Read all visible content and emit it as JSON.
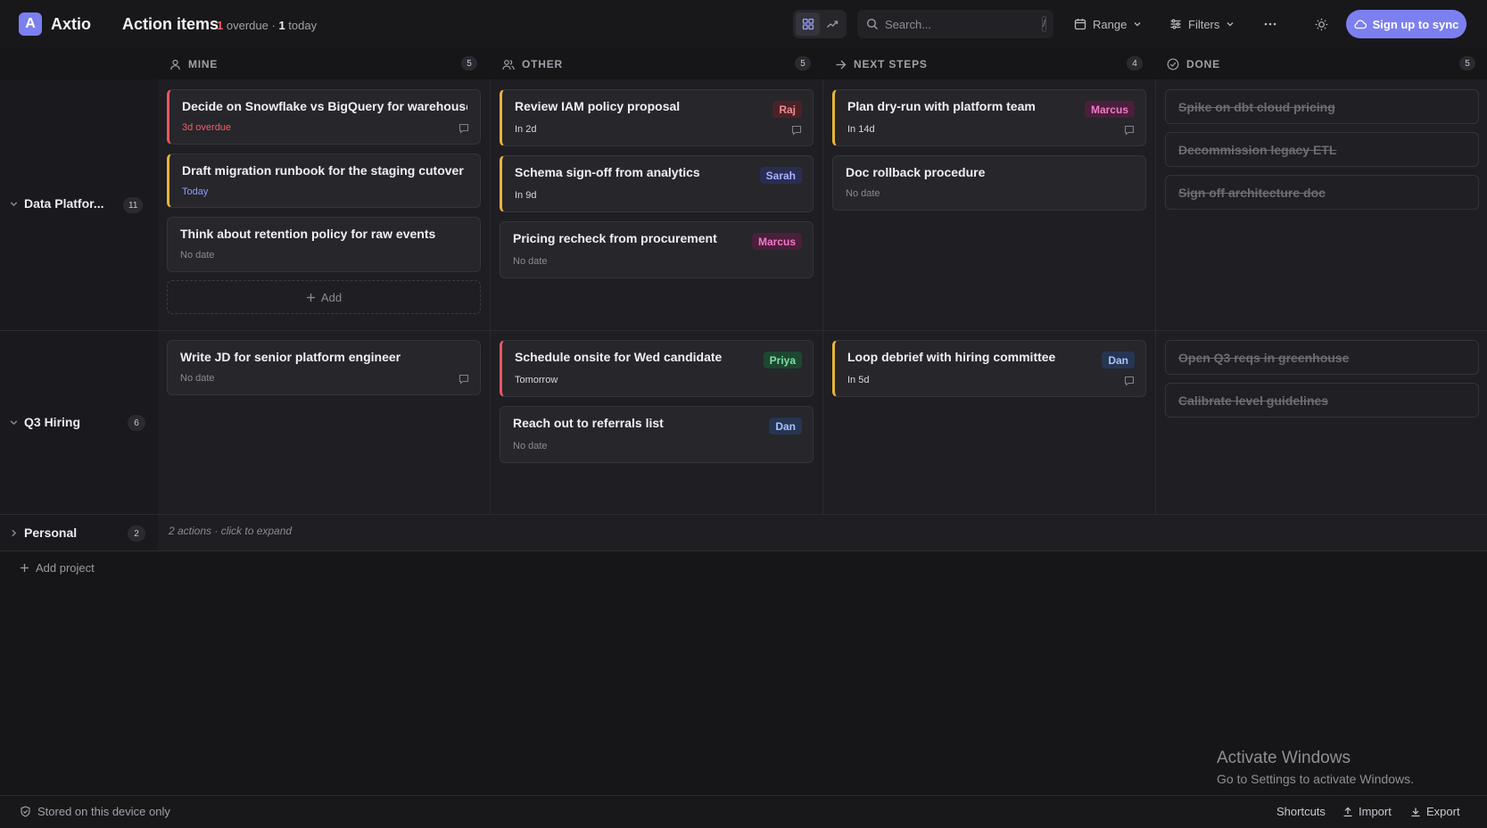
{
  "app": {
    "logo_letter": "A",
    "name": "Axtio",
    "page_title": "Action items"
  },
  "summary": {
    "overdue_count": "1",
    "overdue_label": "overdue",
    "separator": "·",
    "today_count": "1",
    "today_label": "today"
  },
  "toolbar": {
    "search_placeholder": "Search...",
    "search_shortcut": "/",
    "range_label": "Range",
    "filters_label": "Filters",
    "signup_label": "Sign up to sync"
  },
  "columns": [
    {
      "label": "MINE",
      "count": "5"
    },
    {
      "label": "OTHER",
      "count": "5"
    },
    {
      "label": "NEXT STEPS",
      "count": "4"
    },
    {
      "label": "DONE",
      "count": "5"
    }
  ],
  "projects": [
    {
      "name": "Data Platfor...",
      "count": "11",
      "mine": [
        {
          "title": "Decide on Snowflake vs BigQuery for warehouse",
          "meta": "3d overdue"
        },
        {
          "title": "Draft migration runbook for the staging cutover",
          "meta": "Today"
        },
        {
          "title": "Think about retention policy for raw events",
          "meta": "No date"
        }
      ],
      "add_label": "Add",
      "other": [
        {
          "title": "Review IAM policy proposal",
          "meta": "In 2d",
          "owner": "Raj"
        },
        {
          "title": "Schema sign-off from analytics",
          "meta": "In 9d",
          "owner": "Sarah"
        },
        {
          "title": "Pricing recheck from procurement",
          "meta": "No date",
          "owner": "Marcus"
        }
      ],
      "next": [
        {
          "title": "Plan dry-run with platform team",
          "meta": "In 14d",
          "owner": "Marcus"
        },
        {
          "title": "Doc rollback procedure",
          "meta": "No date"
        }
      ],
      "done": [
        "Spike on dbt cloud pricing",
        "Decommission legacy ETL",
        "Sign off architecture doc"
      ]
    },
    {
      "name": "Q3 Hiring",
      "count": "6",
      "mine": [
        {
          "title": "Write JD for senior platform engineer",
          "meta": "No date"
        }
      ],
      "other": [
        {
          "title": "Schedule onsite for Wed candidate",
          "meta": "Tomorrow",
          "owner": "Priya"
        },
        {
          "title": "Reach out to referrals list",
          "meta": "No date",
          "owner": "Dan"
        }
      ],
      "next": [
        {
          "title": "Loop debrief with hiring committee",
          "meta": "In 5d",
          "owner": "Dan"
        }
      ],
      "done": [
        "Open Q3 reqs in greenhouse",
        "Calibrate level guidelines"
      ]
    },
    {
      "name": "Personal",
      "count": "2",
      "collapsed_note": "2 actions · click to expand"
    }
  ],
  "add_project_label": "Add project",
  "footer": {
    "storage_note": "Stored on this device only",
    "shortcuts_label": "Shortcuts",
    "import_label": "Import",
    "export_label": "Export"
  },
  "watermark": {
    "line1": "Activate Windows",
    "line2": "Go to Settings to activate Windows."
  },
  "colors": {
    "accent": "#7c7ff0",
    "overdue": "#e8565f",
    "due_soon": "#e8b43a",
    "today": "#8f9cff"
  },
  "icons": [
    "board-view-icon",
    "trend-view-icon",
    "search-icon",
    "calendar-icon",
    "filters-icon",
    "more-icon",
    "sun-icon",
    "cloud-icon",
    "user-icon",
    "users-icon",
    "arrow-right-icon",
    "check-circle-icon",
    "chevron-down-icon",
    "chevron-right-icon",
    "comment-icon",
    "plus-icon",
    "shield-icon",
    "upload-icon",
    "download-icon"
  ]
}
